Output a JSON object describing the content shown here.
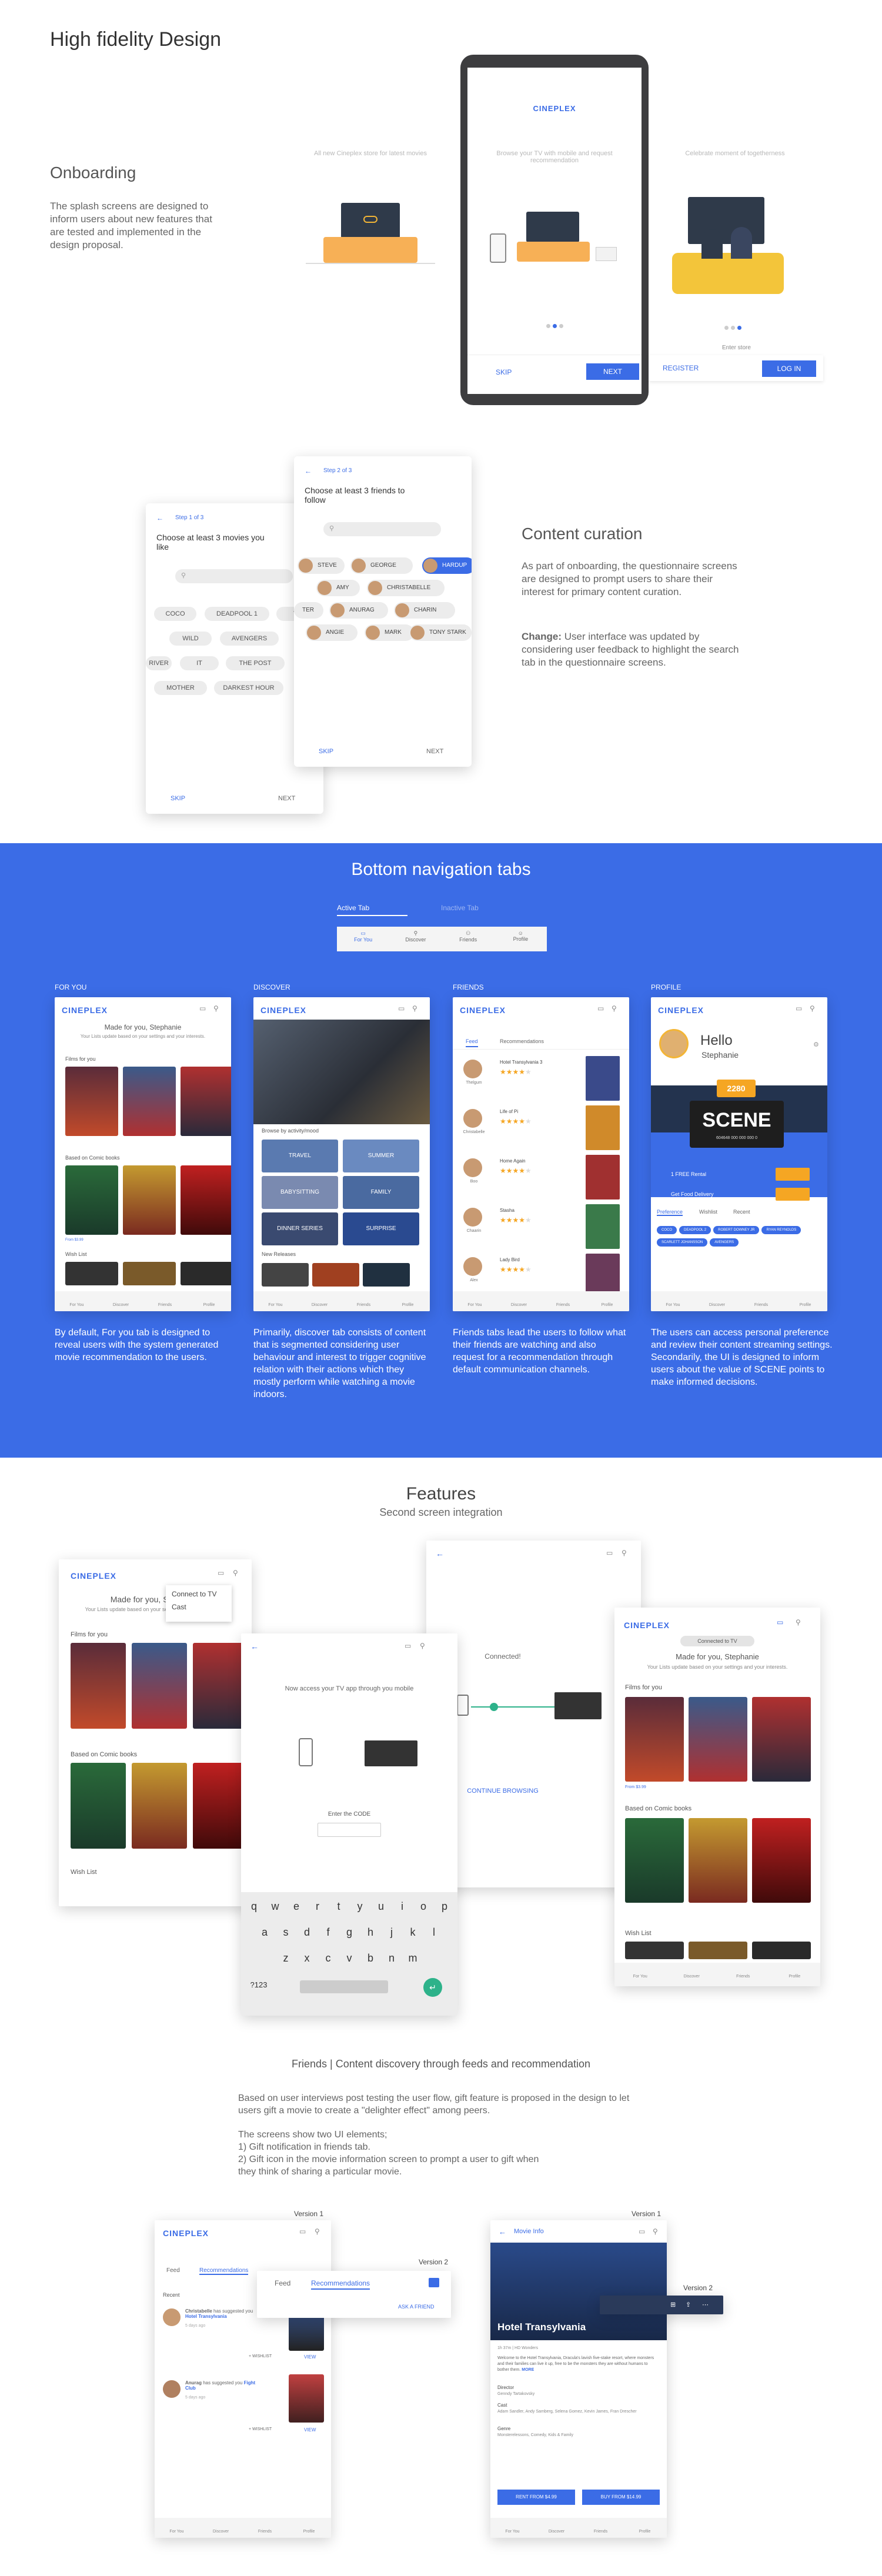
{
  "page": {
    "title": "High fidelity Design"
  },
  "onboarding": {
    "heading": "Onboarding",
    "body": "The splash screens are designed to inform users about new features that are tested and implemented in the design proposal.",
    "logo": "CINEPLEX",
    "slide1": "All new Cineplex store for latest movies",
    "slide2": "Browse your TV with mobile and request recommendation",
    "slide3": "Celebrate moment of togetherness",
    "skip": "SKIP",
    "next": "NEXT",
    "register": "REGISTER",
    "login": "LOG IN",
    "enter_store": "Enter store"
  },
  "curation": {
    "heading": "Content curation",
    "body1": "As part of onboarding, the questionnaire screens are designed to prompt users to share their interest for primary content curation.",
    "change_label": "Change:",
    "body2": " User interface was updated by considering user feedback to highlight the search tab in the questionnaire screens.",
    "step1": {
      "step": "Step 1 of 3",
      "title": "Choose at least 3 movies you like",
      "chips": [
        "COCO",
        "DEADPOOL 1",
        "TER",
        "WILD",
        "AVENGERS",
        "RIVER",
        "IT",
        "THE POST",
        "MOTHER",
        "DARKEST HOUR"
      ],
      "skip": "SKIP",
      "next": "NEXT"
    },
    "step2": {
      "step": "Step 2 of 3",
      "title": "Choose at least 3 friends to follow",
      "people": [
        "STEVE",
        "GEORGE",
        "HARDUP",
        "AMY",
        "CHRISTABELLE",
        "TER",
        "ANURAG",
        "CHARIN",
        "ANGIE",
        "MARK",
        "TONY STARK"
      ],
      "skip": "SKIP",
      "next": "NEXT"
    }
  },
  "bottom": {
    "heading": "Bottom navigation tabs",
    "active": "Active Tab",
    "inactive": "Inactive Tab",
    "tabs": [
      "For You",
      "Discover",
      "Friends",
      "Profile"
    ],
    "cols": [
      {
        "label": "FOR YOU",
        "desc": "By default, For you tab is designed to reveal users with the system generated movie recommendation to the users."
      },
      {
        "label": "DISCOVER",
        "desc": "Primarily, discover tab consists of content that is segmented considering user behaviour and interest to trigger cognitive relation with their actions which they mostly perform while watching a movie indoors."
      },
      {
        "label": "FRIENDS",
        "desc": "Friends tabs lead the users to follow what their friends are watching and also request for a recommendation through default communication channels."
      },
      {
        "label": "PROFILE",
        "desc": "The users can access personal preference and review their content streaming settings. Secondarily, the UI is designed to inform users about the value of SCENE points to make informed decisions."
      }
    ],
    "foryou": {
      "made": "Made for you, Stephanie",
      "sub": "Your Lists update based on your settings and your interests.",
      "films": "Films for you",
      "comic": "Based on Comic books",
      "wish": "Wish List",
      "price": "From $3.99"
    },
    "discover": {
      "browse": "Browse by activity/mood",
      "moods": [
        "TRAVEL",
        "SUMMER",
        "BABYSITTING",
        "FAMILY",
        "DINNER SERIES",
        "SURPRISE"
      ],
      "new": "New Releases"
    },
    "friends": {
      "tabs": [
        "Feed",
        "Recommendations"
      ],
      "items": [
        {
          "t": "Hotel Transylvania 3",
          "n": "Thelgum"
        },
        {
          "t": "Life of Pi",
          "n": "Christabelle"
        },
        {
          "t": "Home Again",
          "n": "Boo"
        },
        {
          "t": "Stasha",
          "n": "Chaarin"
        },
        {
          "t": "Lady Bird",
          "n": "Alex"
        }
      ]
    },
    "profile": {
      "hello": "Hello",
      "name": "Stephanie",
      "points": "2280",
      "scene": "SCENE",
      "card": "604648 000 000 000 0",
      "rental": "1 FREE Rental",
      "food": "Get Food Delivery",
      "tabs": [
        "Preference",
        "Wishlist",
        "Recent"
      ],
      "chips": [
        "COCO",
        "DEADPOOL 2",
        "ROBERT DOWNEY JR",
        "RYAN REYNOLDS",
        "SCARLETT JOHANSSON",
        "AVENGERS"
      ]
    }
  },
  "features": {
    "heading": "Features",
    "sub": "Second screen integration",
    "connect": "Connect to TV",
    "cast": "Cast",
    "access": "Now access your TV app through you mobile",
    "enter_code": "Enter the CODE",
    "connected": "Connected!",
    "cont": "CONTINUE BROWSING",
    "connected_tv": "Connected to TV",
    "keys1": [
      "q",
      "w",
      "e",
      "r",
      "t",
      "y",
      "u",
      "i",
      "o",
      "p"
    ],
    "keys2": [
      "a",
      "s",
      "d",
      "f",
      "g",
      "h",
      "j",
      "k",
      "l"
    ],
    "keys3": [
      "z",
      "x",
      "c",
      "v",
      "b",
      "n",
      "m"
    ],
    "kb_num": "?123"
  },
  "friendsec": {
    "heading": "Friends | Content discovery through feeds and recommendation",
    "p1": "Based on user interviews post testing the user flow, gift feature is proposed in the design to let users gift a movie to create a \"delighter effect\" among peers.",
    "p2": "The screens show two UI elements;",
    "p3": "1) Gift notification in friends tab.",
    "p4": "2) Gift icon in the movie information screen to prompt a user to gift when they think of sharing a particular movie.",
    "v1": "Version 1",
    "v2": "Version 2",
    "feed": "Feed",
    "recs": "Recommendations",
    "recent": "Recent",
    "n1a": "Christabelle",
    "n1b": " has suggested you ",
    "n1c": "Hotel Transylvania",
    "n2a": "Anurag",
    "n2b": " has suggested you ",
    "n2c": "Fight Club",
    "ago": "5 days ago",
    "wishlist": "+ WISHLIST",
    "view": "VIEW",
    "ask": "ASK A FRIEND",
    "movie_info": "Movie Info",
    "movie_title": "Hotel Transylvania",
    "meta": "1h 37m | HD Wonders",
    "desc": "Welcome to the Hotel Transylvania, Dracula's lavish five-stake resort, where monsters and their families can live it up, free to be the monsters they are without humans to bother them.",
    "more": "MORE",
    "director_l": "Director",
    "director": "Genndy Tartakovsky",
    "cast_l": "Cast",
    "cast": "Adam Sandler, Andy Samberg, Selena Gomez, Kevin James, Fran Drescher",
    "genre_l": "Genre",
    "genre": "Monsterelessons, Comedy, Kids & Family",
    "rent": "RENT FROM $4.99",
    "buy": "BUY FROM $14.99"
  },
  "colors": {
    "accent": "#3b6ce6",
    "navy": "#23334e",
    "orange": "#f5a623",
    "yellow": "#f3b536"
  }
}
